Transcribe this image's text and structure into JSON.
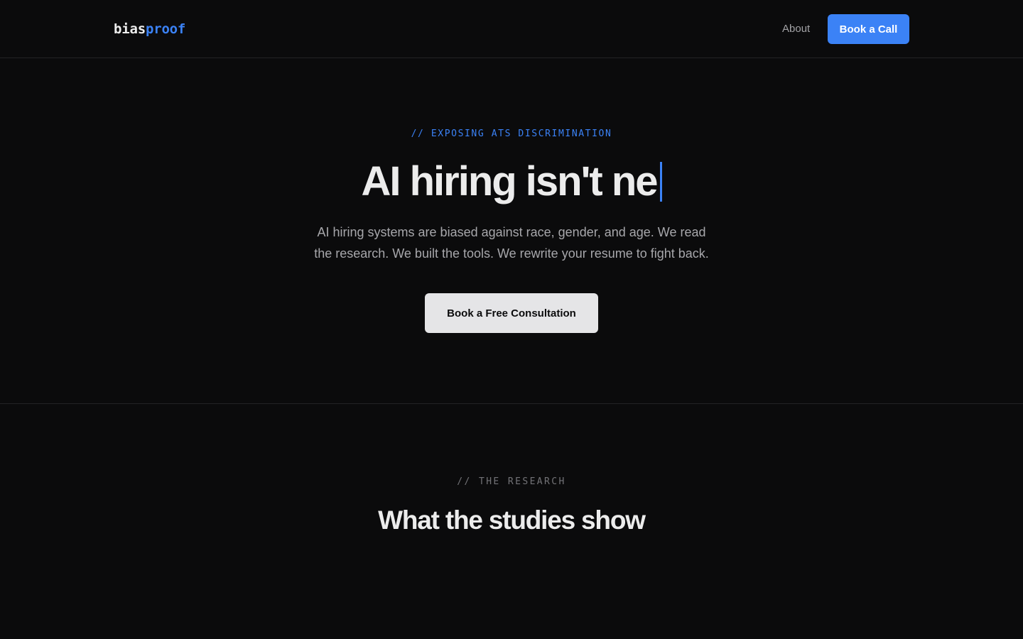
{
  "header": {
    "logo": {
      "part_a": "bias",
      "part_b": "proof"
    },
    "nav": {
      "about_label": "About"
    },
    "cta_label": "Book a Call"
  },
  "hero": {
    "eyebrow": "// EXPOSING ATS DISCRIMINATION",
    "headline": "AI hiring isn't ne",
    "subtext_line1": "AI hiring systems are biased against race, gender, and age. We read",
    "subtext_line2": "the research. We built the tools. We rewrite your resume to fight back.",
    "cta_label": "Book a Free Consultation"
  },
  "research": {
    "eyebrow": "// THE RESEARCH",
    "title": "What the studies show"
  },
  "colors": {
    "background": "#0b0b0c",
    "accent": "#3b82f6",
    "text": "#ececec",
    "muted_text": "#a7a7ab",
    "divider": "#232325",
    "light_button": "#e5e5e7"
  }
}
